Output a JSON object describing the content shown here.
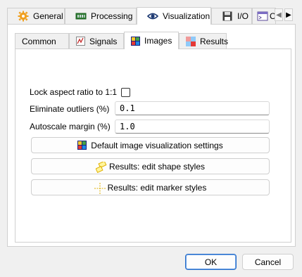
{
  "main_tabs": [
    {
      "label": "General",
      "icon": "gear-icon"
    },
    {
      "label": "Processing",
      "icon": "chip-icon"
    },
    {
      "label": "Visualization",
      "icon": "eye-icon",
      "active": true
    },
    {
      "label": "I/O",
      "icon": "floppy-disk-icon"
    },
    {
      "label": "C",
      "icon": "console-icon"
    }
  ],
  "tab_scroll": {
    "left": "◀",
    "right": "▶"
  },
  "sub_tabs": [
    {
      "label": "Common"
    },
    {
      "label": "Signals",
      "icon": "signal-icon"
    },
    {
      "label": "Images",
      "icon": "image-icon",
      "active": true
    },
    {
      "label": "Results",
      "icon": "results-grid-icon"
    }
  ],
  "form": {
    "lock_aspect_label": "Lock aspect ratio to 1:1",
    "lock_aspect_checked": false,
    "outliers_label": "Eliminate outliers (%)",
    "outliers_value": "0.1",
    "autoscale_label": "Autoscale margin (%)",
    "autoscale_value": "1.0"
  },
  "buttons": {
    "default_image_settings": "Default image visualization settings",
    "edit_shape_styles": "Results: edit shape styles",
    "edit_marker_styles": "Results: edit marker styles"
  },
  "dialog": {
    "ok": "OK",
    "cancel": "Cancel"
  },
  "colors": {
    "accent": "#2a6fc9",
    "gear": "#f0a020",
    "eye": "#1f3b73"
  }
}
